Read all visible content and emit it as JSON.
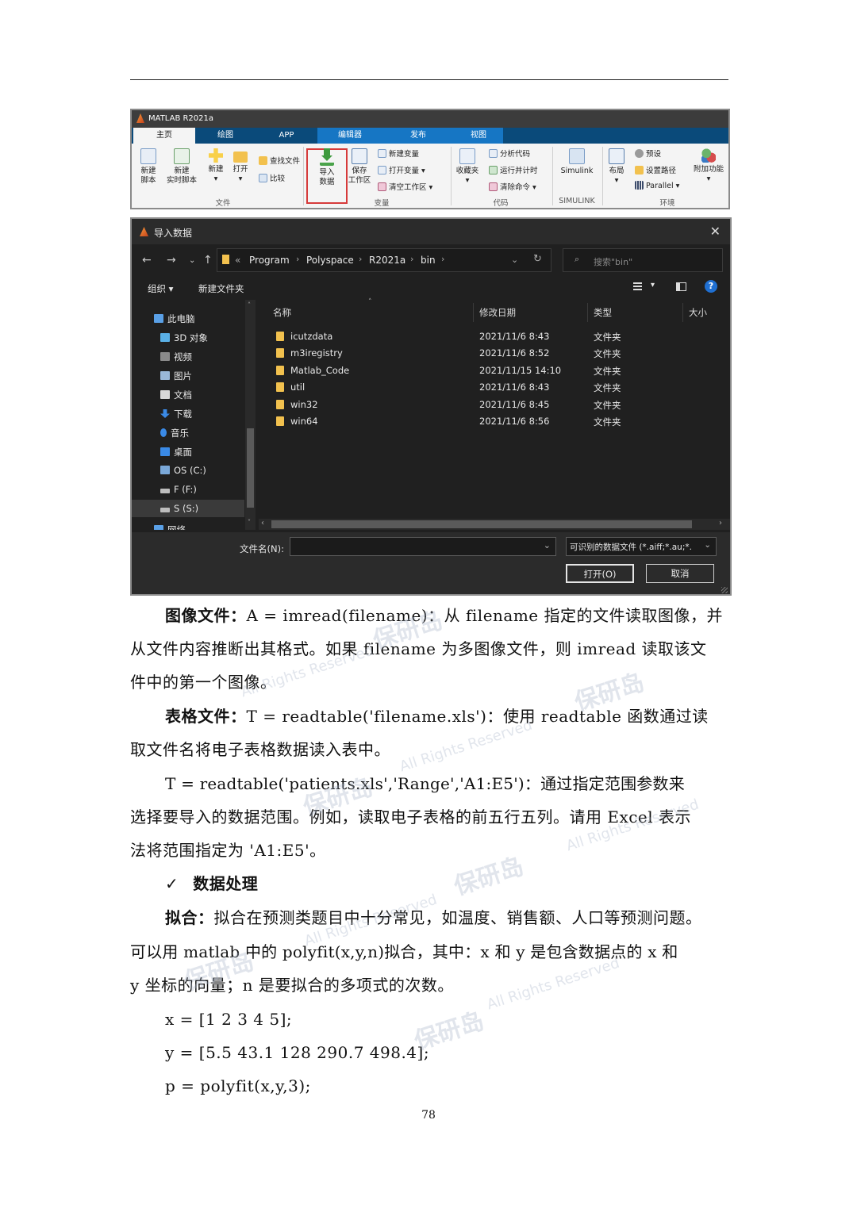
{
  "matlab": {
    "title": "MATLAB R2021a",
    "tabs": [
      "主页",
      "绘图",
      "APP",
      "编辑器",
      "发布",
      "视图"
    ],
    "buttons": {
      "new_script": [
        "新建",
        "脚本"
      ],
      "new_live_script": [
        "新建",
        "实时脚本"
      ],
      "new": "新建",
      "open": "打开",
      "find_files": "查找文件",
      "compare": "比较",
      "import_data": [
        "导入",
        "数据"
      ],
      "save_workspace": [
        "保存",
        "工作区"
      ],
      "new_variable": "新建变量",
      "open_variable": "打开变量 ▾",
      "clear_workspace": "清空工作区 ▾",
      "favorites": "收藏夹",
      "analyze_code": "分析代码",
      "run_and_time": "运行并计时",
      "clear_commands": "清除命令 ▾",
      "simulink": "Simulink",
      "layout": "布局",
      "preferences": "预设",
      "set_path": "设置路径",
      "parallel": "Parallel ▾",
      "addons": "附加功能"
    },
    "sections": [
      "文件",
      "变量",
      "代码",
      "SIMULINK",
      "环境"
    ]
  },
  "dialog": {
    "title": "导入数据",
    "breadcrumb": [
      "«",
      "Program",
      "Polyspace",
      "R2021a",
      "bin"
    ],
    "search_placeholder": "搜索\"bin\"",
    "organize": "组织 ▾",
    "new_folder": "新建文件夹",
    "sidebar": [
      "此电脑",
      "3D 对象",
      "视频",
      "图片",
      "文档",
      "下载",
      "音乐",
      "桌面",
      "OS (C:)",
      "F (F:)",
      "S (S:)",
      "网络"
    ],
    "columns": [
      "名称",
      "修改日期",
      "类型",
      "大小"
    ],
    "files": [
      {
        "name": "icutzdata",
        "date": "2021/11/6 8:43",
        "type": "文件夹"
      },
      {
        "name": "m3iregistry",
        "date": "2021/11/6 8:52",
        "type": "文件夹"
      },
      {
        "name": "Matlab_Code",
        "date": "2021/11/15 14:10",
        "type": "文件夹"
      },
      {
        "name": "util",
        "date": "2021/11/6 8:43",
        "type": "文件夹"
      },
      {
        "name": "win32",
        "date": "2021/11/6 8:45",
        "type": "文件夹"
      },
      {
        "name": "win64",
        "date": "2021/11/6 8:56",
        "type": "文件夹"
      }
    ],
    "filename_label": "文件名(N):",
    "filetype": "可识别的数据文件 (*.aiff;*.au;*.",
    "open_button": "打开(O)",
    "cancel_button": "取消"
  },
  "text": {
    "p1_label": "图像文件：",
    "p1_l1": "A = imread(filename)：从 filename 指定的文件读取图像，并",
    "p1_l2": "从文件内容推断出其格式。如果 filename 为多图像文件，则 imread 读取该文",
    "p1_l3": "件中的第一个图像。",
    "p2_label": "表格文件：",
    "p2_l1": "T = readtable('filename.xls')：使用 readtable 函数通过读",
    "p2_l2": "取文件名将电子表格数据读入表中。",
    "p3_l1": "T = readtable('patients.xls','Range','A1:E5')：通过指定范围参数来",
    "p3_l2": "选择要导入的数据范围。例如，读取电子表格的前五行五列。请用 Excel 表示",
    "p3_l3": "法将范围指定为 'A1:E5'。",
    "check": "✓",
    "section_title": "数据处理",
    "p4_label": "拟合：",
    "p4_l1": "拟合在预测类题目中十分常见，如温度、销售额、人口等预测问题。",
    "p4_l2": "可以用 matlab 中的 polyfit(x,y,n)拟合，其中：x 和 y 是包含数据点的 x 和",
    "p4_l3": "y 坐标的向量；n 是要拟合的多项式的次数。",
    "code1": "x = [1 2 3 4 5];",
    "code2": "y = [5.5 43.1 128 290.7 498.4];",
    "code3": "p = polyfit(x,y,3);",
    "page_number": "78"
  },
  "watermark": {
    "logo": "保研岛",
    "rights": "All Rights Reserved"
  }
}
